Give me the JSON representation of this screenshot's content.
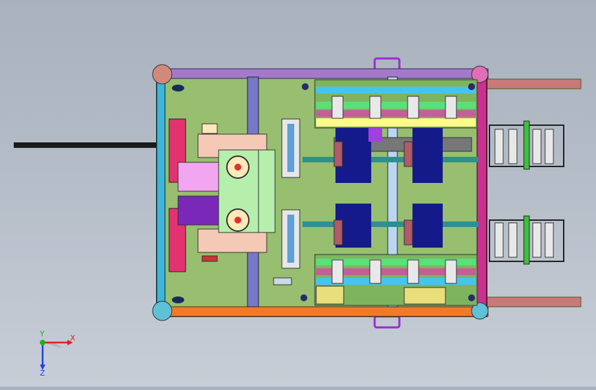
{
  "viewport": {
    "background_top": "#a9b1bd",
    "background_bottom": "#c7ced7",
    "model_plate_color": "#97bf6f"
  },
  "triad": {
    "x_label": "X",
    "y_label": "Y",
    "z_label": "Z",
    "x_color": "#e02020",
    "y_color": "#20b020",
    "z_color": "#2040e0"
  }
}
